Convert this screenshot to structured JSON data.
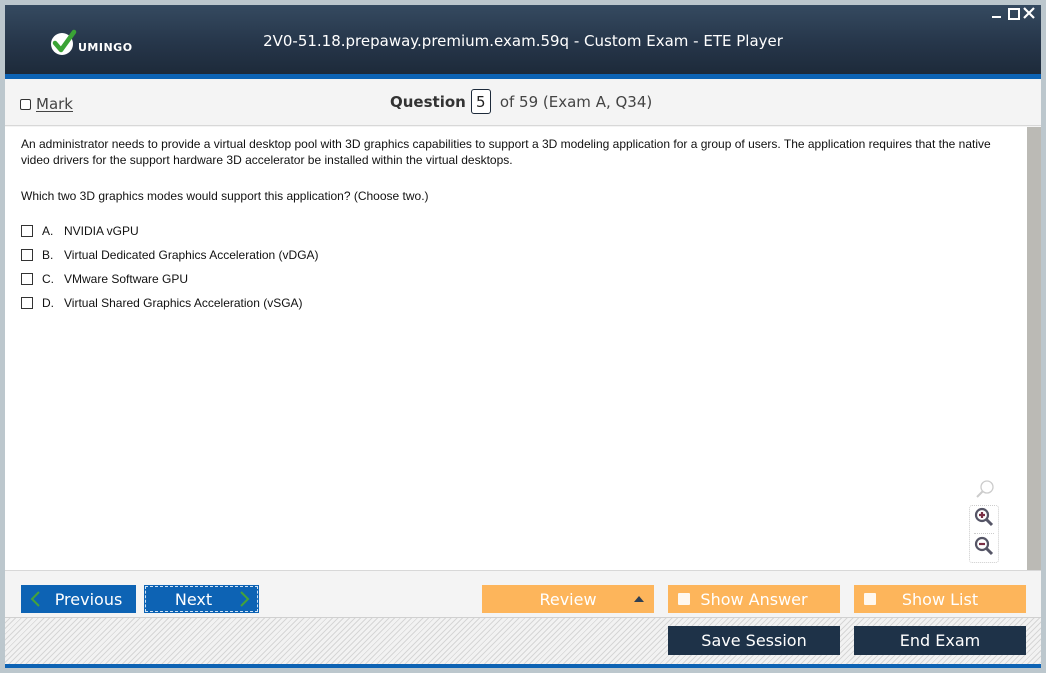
{
  "window": {
    "title": "2V0-51.18.prepaway.premium.exam.59q - Custom Exam - ETE Player",
    "logo_text": "UMINGO",
    "controls": [
      "minimize",
      "maximize",
      "close"
    ]
  },
  "header": {
    "mark_label": "Mark",
    "mark_checked": false,
    "question_label": "Question",
    "question_number": "5",
    "question_suffix": "of 59 (Exam A, Q34)"
  },
  "question": {
    "stem": "An administrator needs to provide a virtual desktop pool with 3D graphics capabilities to support a 3D modeling application for a group of users. The application requires that the native video drivers for the support hardware 3D accelerator be installed within the virtual desktops.",
    "prompt": "Which two 3D graphics modes would support this application? (Choose two.)",
    "options": [
      {
        "letter": "A.",
        "text": "NVIDIA vGPU",
        "checked": false
      },
      {
        "letter": "B.",
        "text": "Virtual Dedicated Graphics Acceleration (vDGA)",
        "checked": false
      },
      {
        "letter": "C.",
        "text": "VMware Software GPU",
        "checked": false
      },
      {
        "letter": "D.",
        "text": "Virtual Shared Graphics Acceleration (vSGA)",
        "checked": false
      }
    ]
  },
  "zoom_tools": [
    "zoom-reset-icon",
    "zoom-in-icon",
    "zoom-out-icon"
  ],
  "navigation": {
    "previous_label": "Previous",
    "next_label": "Next",
    "review_label": "Review",
    "show_answer_label": "Show Answer",
    "show_list_label": "Show List"
  },
  "footer": {
    "save_session_label": "Save Session",
    "end_exam_label": "End Exam"
  },
  "colors": {
    "title_bar": "#26364a",
    "accent_blue": "#0d63b4",
    "orange": "#fdb55b",
    "dark_button": "#1e3248",
    "logo_green": "#3aa335"
  }
}
